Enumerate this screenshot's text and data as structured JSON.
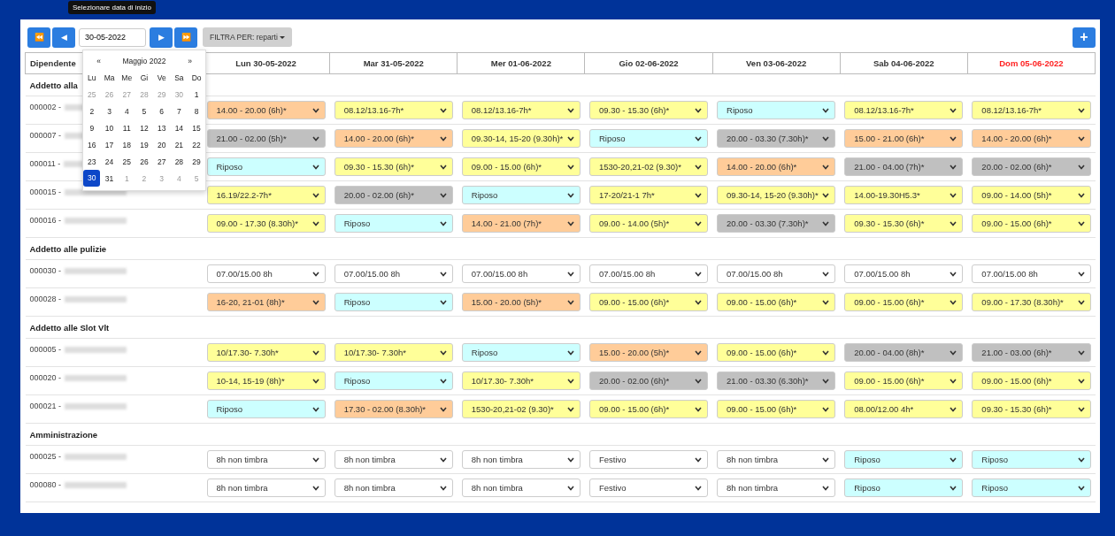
{
  "tooltip": "Selezionare data di inizio",
  "toolbar": {
    "first_button": "⏪",
    "prev_button": "◀",
    "date_value": "30-05-2022",
    "next_button": "▶",
    "last_button": "⏩",
    "filter_button": "FILTRA PER: reparti",
    "add_button": "+"
  },
  "datepicker": {
    "prev": "«",
    "title": "Maggio 2022",
    "next": "»",
    "weekdays": [
      "Lu",
      "Ma",
      "Me",
      "Gi",
      "Ve",
      "Sa",
      "Do"
    ],
    "weeks": [
      [
        {
          "label": "25",
          "muted": true,
          "selected": false
        },
        {
          "label": "26",
          "muted": true,
          "selected": false
        },
        {
          "label": "27",
          "muted": true,
          "selected": false
        },
        {
          "label": "28",
          "muted": true,
          "selected": false
        },
        {
          "label": "29",
          "muted": true,
          "selected": false
        },
        {
          "label": "30",
          "muted": true,
          "selected": false
        },
        {
          "label": "1",
          "muted": false,
          "selected": false
        }
      ],
      [
        {
          "label": "2",
          "muted": false,
          "selected": false
        },
        {
          "label": "3",
          "muted": false,
          "selected": false
        },
        {
          "label": "4",
          "muted": false,
          "selected": false
        },
        {
          "label": "5",
          "muted": false,
          "selected": false
        },
        {
          "label": "6",
          "muted": false,
          "selected": false
        },
        {
          "label": "7",
          "muted": false,
          "selected": false
        },
        {
          "label": "8",
          "muted": false,
          "selected": false
        }
      ],
      [
        {
          "label": "9",
          "muted": false,
          "selected": false
        },
        {
          "label": "10",
          "muted": false,
          "selected": false
        },
        {
          "label": "11",
          "muted": false,
          "selected": false
        },
        {
          "label": "12",
          "muted": false,
          "selected": false
        },
        {
          "label": "13",
          "muted": false,
          "selected": false
        },
        {
          "label": "14",
          "muted": false,
          "selected": false
        },
        {
          "label": "15",
          "muted": false,
          "selected": false
        }
      ],
      [
        {
          "label": "16",
          "muted": false,
          "selected": false
        },
        {
          "label": "17",
          "muted": false,
          "selected": false
        },
        {
          "label": "18",
          "muted": false,
          "selected": false
        },
        {
          "label": "19",
          "muted": false,
          "selected": false
        },
        {
          "label": "20",
          "muted": false,
          "selected": false
        },
        {
          "label": "21",
          "muted": false,
          "selected": false
        },
        {
          "label": "22",
          "muted": false,
          "selected": false
        }
      ],
      [
        {
          "label": "23",
          "muted": false,
          "selected": false
        },
        {
          "label": "24",
          "muted": false,
          "selected": false
        },
        {
          "label": "25",
          "muted": false,
          "selected": false
        },
        {
          "label": "26",
          "muted": false,
          "selected": false
        },
        {
          "label": "27",
          "muted": false,
          "selected": false
        },
        {
          "label": "28",
          "muted": false,
          "selected": false
        },
        {
          "label": "29",
          "muted": false,
          "selected": false
        }
      ],
      [
        {
          "label": "30",
          "muted": false,
          "selected": true
        },
        {
          "label": "31",
          "muted": false,
          "selected": false
        },
        {
          "label": "1",
          "muted": true,
          "selected": false
        },
        {
          "label": "2",
          "muted": true,
          "selected": false
        },
        {
          "label": "3",
          "muted": true,
          "selected": false
        },
        {
          "label": "4",
          "muted": true,
          "selected": false
        },
        {
          "label": "5",
          "muted": true,
          "selected": false
        }
      ]
    ]
  },
  "table": {
    "first_column": "Dipendente",
    "columns": [
      {
        "label": "Lun 30-05-2022",
        "holiday": false
      },
      {
        "label": "Mar 31-05-2022",
        "holiday": false
      },
      {
        "label": "Mer 01-06-2022",
        "holiday": false
      },
      {
        "label": "Gio 02-06-2022",
        "holiday": false
      },
      {
        "label": "Ven 03-06-2022",
        "holiday": false
      },
      {
        "label": "Sab 04-06-2022",
        "holiday": false
      },
      {
        "label": "Dom 05-06-2022",
        "holiday": true
      }
    ],
    "groups": [
      {
        "name": "Addetto alla",
        "employees": [
          {
            "code": "000002 -",
            "shifts": [
              {
                "text": "14.00 - 20.00 (6h)*",
                "color": "#ffcc99"
              },
              {
                "text": "08.12/13.16-7h*",
                "color": "#ffff99"
              },
              {
                "text": "08.12/13.16-7h*",
                "color": "#ffff99"
              },
              {
                "text": "09.30 - 15.30 (6h)*",
                "color": "#ffff99"
              },
              {
                "text": "Riposo",
                "color": "#ccffff"
              },
              {
                "text": "08.12/13.16-7h*",
                "color": "#ffff99"
              },
              {
                "text": "08.12/13.16-7h*",
                "color": "#ffff99"
              }
            ]
          },
          {
            "code": "000007 -",
            "shifts": [
              {
                "text": "21.00 - 02.00 (5h)*",
                "color": "#c0c0c0"
              },
              {
                "text": "14.00 - 20.00 (6h)*",
                "color": "#ffcc99"
              },
              {
                "text": "09.30-14, 15-20 (9.30h)*",
                "color": "#ffff99"
              },
              {
                "text": "Riposo",
                "color": "#ccffff"
              },
              {
                "text": "20.00 - 03.30 (7.30h)*",
                "color": "#c0c0c0"
              },
              {
                "text": "15.00 - 21.00 (6h)*",
                "color": "#ffcc99"
              },
              {
                "text": "14.00 - 20.00 (6h)*",
                "color": "#ffcc99"
              }
            ]
          },
          {
            "code": "000011 -",
            "shifts": [
              {
                "text": "Riposo",
                "color": "#ccffff"
              },
              {
                "text": "09.30 - 15.30 (6h)*",
                "color": "#ffff99"
              },
              {
                "text": "09.00 - 15.00 (6h)*",
                "color": "#ffff99"
              },
              {
                "text": "1530-20,21-02 (9.30)*",
                "color": "#ffff99"
              },
              {
                "text": "14.00 - 20.00 (6h)*",
                "color": "#ffcc99"
              },
              {
                "text": "21.00 - 04.00 (7h)*",
                "color": "#c0c0c0"
              },
              {
                "text": "20.00 - 02.00 (6h)*",
                "color": "#c0c0c0"
              }
            ]
          },
          {
            "code": "000015 -",
            "shifts": [
              {
                "text": "16.19/22.2-7h*",
                "color": "#ffff99"
              },
              {
                "text": "20.00 - 02.00 (6h)*",
                "color": "#c0c0c0"
              },
              {
                "text": "Riposo",
                "color": "#ccffff"
              },
              {
                "text": "17-20/21-1 7h*",
                "color": "#ffff99"
              },
              {
                "text": "09.30-14, 15-20 (9.30h)*",
                "color": "#ffff99"
              },
              {
                "text": "14.00-19.30H5.3*",
                "color": "#ffff99"
              },
              {
                "text": "09.00 - 14.00 (5h)*",
                "color": "#ffff99"
              }
            ]
          },
          {
            "code": "000016 -",
            "shifts": [
              {
                "text": "09.00 - 17.30 (8.30h)*",
                "color": "#ffff99"
              },
              {
                "text": "Riposo",
                "color": "#ccffff"
              },
              {
                "text": "14.00 - 21.00 (7h)*",
                "color": "#ffcc99"
              },
              {
                "text": "09.00 - 14.00 (5h)*",
                "color": "#ffff99"
              },
              {
                "text": "20.00 - 03.30 (7.30h)*",
                "color": "#c0c0c0"
              },
              {
                "text": "09.30 - 15.30 (6h)*",
                "color": "#ffff99"
              },
              {
                "text": "09.00 - 15.00 (6h)*",
                "color": "#ffff99"
              }
            ]
          }
        ]
      },
      {
        "name": "Addetto alle pulizie",
        "employees": [
          {
            "code": "000030 -",
            "shifts": [
              {
                "text": "07.00/15.00 8h",
                "color": "#ffffff"
              },
              {
                "text": "07.00/15.00 8h",
                "color": "#ffffff"
              },
              {
                "text": "07.00/15.00 8h",
                "color": "#ffffff"
              },
              {
                "text": "07.00/15.00 8h",
                "color": "#ffffff"
              },
              {
                "text": "07.00/15.00 8h",
                "color": "#ffffff"
              },
              {
                "text": "07.00/15.00 8h",
                "color": "#ffffff"
              },
              {
                "text": "07.00/15.00 8h",
                "color": "#ffffff"
              }
            ]
          },
          {
            "code": "000028 -",
            "shifts": [
              {
                "text": "16-20, 21-01 (8h)*",
                "color": "#ffcc99"
              },
              {
                "text": "Riposo",
                "color": "#ccffff"
              },
              {
                "text": "15.00 - 20.00 (5h)*",
                "color": "#ffcc99"
              },
              {
                "text": "09.00 - 15.00 (6h)*",
                "color": "#ffff99"
              },
              {
                "text": "09.00 - 15.00 (6h)*",
                "color": "#ffff99"
              },
              {
                "text": "09.00 - 15.00 (6h)*",
                "color": "#ffff99"
              },
              {
                "text": "09.00 - 17.30 (8.30h)*",
                "color": "#ffff99"
              }
            ]
          }
        ]
      },
      {
        "name": "Addetto alle Slot Vlt",
        "employees": [
          {
            "code": "000005 -",
            "shifts": [
              {
                "text": "10/17.30- 7.30h*",
                "color": "#ffff99"
              },
              {
                "text": "10/17.30- 7.30h*",
                "color": "#ffff99"
              },
              {
                "text": "Riposo",
                "color": "#ccffff"
              },
              {
                "text": "15.00 - 20.00 (5h)*",
                "color": "#ffcc99"
              },
              {
                "text": "09.00 - 15.00 (6h)*",
                "color": "#ffff99"
              },
              {
                "text": "20.00 - 04.00 (8h)*",
                "color": "#c0c0c0"
              },
              {
                "text": "21.00 - 03.00 (6h)*",
                "color": "#c0c0c0"
              }
            ]
          },
          {
            "code": "000020 -",
            "shifts": [
              {
                "text": "10-14, 15-19 (8h)*",
                "color": "#ffff99"
              },
              {
                "text": "Riposo",
                "color": "#ccffff"
              },
              {
                "text": "10/17.30- 7.30h*",
                "color": "#ffff99"
              },
              {
                "text": "20.00 - 02.00 (6h)*",
                "color": "#c0c0c0"
              },
              {
                "text": "21.00 - 03.30 (6.30h)*",
                "color": "#c0c0c0"
              },
              {
                "text": "09.00 - 15.00 (6h)*",
                "color": "#ffff99"
              },
              {
                "text": "09.00 - 15.00 (6h)*",
                "color": "#ffff99"
              }
            ]
          },
          {
            "code": "000021 -",
            "shifts": [
              {
                "text": "Riposo",
                "color": "#ccffff"
              },
              {
                "text": "17.30 - 02.00 (8.30h)*",
                "color": "#ffcc99"
              },
              {
                "text": "1530-20,21-02 (9.30)*",
                "color": "#ffff99"
              },
              {
                "text": "09.00 - 15.00 (6h)*",
                "color": "#ffff99"
              },
              {
                "text": "09.00 - 15.00 (6h)*",
                "color": "#ffff99"
              },
              {
                "text": "08.00/12.00 4h*",
                "color": "#ffff99"
              },
              {
                "text": "09.30 - 15.30 (6h)*",
                "color": "#ffff99"
              }
            ]
          }
        ]
      },
      {
        "name": "Amministrazione",
        "employees": [
          {
            "code": "000025 -",
            "shifts": [
              {
                "text": "8h non timbra",
                "color": "#ffffff"
              },
              {
                "text": "8h non timbra",
                "color": "#ffffff"
              },
              {
                "text": "8h non timbra",
                "color": "#ffffff"
              },
              {
                "text": "Festivo",
                "color": "#ffffff"
              },
              {
                "text": "8h non timbra",
                "color": "#ffffff"
              },
              {
                "text": "Riposo",
                "color": "#ccffff"
              },
              {
                "text": "Riposo",
                "color": "#ccffff"
              }
            ]
          },
          {
            "code": "000080 -",
            "shifts": [
              {
                "text": "8h non timbra",
                "color": "#ffffff"
              },
              {
                "text": "8h non timbra",
                "color": "#ffffff"
              },
              {
                "text": "8h non timbra",
                "color": "#ffffff"
              },
              {
                "text": "Festivo",
                "color": "#ffffff"
              },
              {
                "text": "8h non timbra",
                "color": "#ffffff"
              },
              {
                "text": "Riposo",
                "color": "#ccffff"
              },
              {
                "text": "Riposo",
                "color": "#ccffff"
              }
            ]
          }
        ]
      }
    ]
  }
}
